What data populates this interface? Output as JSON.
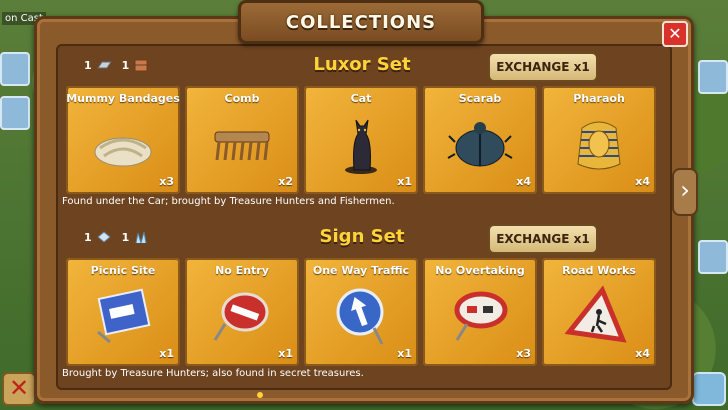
{
  "window": {
    "title": "COLLECTIONS",
    "close_symbol": "✕",
    "next_symbol": "›"
  },
  "scene": {
    "location_label": "on Cast"
  },
  "sets": [
    {
      "title": "Luxor Set",
      "exchange_label": "EXCHANGE x1",
      "requirements": [
        {
          "qty": "1",
          "icon": "metal-bar-icon"
        },
        {
          "qty": "1",
          "icon": "brick-icon"
        }
      ],
      "items": [
        {
          "name": "Mummy Bandages",
          "count": "x3",
          "icon": "bandage-icon"
        },
        {
          "name": "Comb",
          "count": "x2",
          "icon": "comb-icon"
        },
        {
          "name": "Cat",
          "count": "x1",
          "icon": "cat-statue-icon"
        },
        {
          "name": "Scarab",
          "count": "x4",
          "icon": "scarab-icon"
        },
        {
          "name": "Pharaoh",
          "count": "x4",
          "icon": "pharaoh-mask-icon"
        }
      ],
      "description": "Found under the Car; brought by Treasure Hunters and Fishermen."
    },
    {
      "title": "Sign Set",
      "exchange_label": "EXCHANGE x1",
      "requirements": [
        {
          "qty": "1",
          "icon": "glass-icon"
        },
        {
          "qty": "1",
          "icon": "crystal-icon"
        }
      ],
      "items": [
        {
          "name": "Picnic Site",
          "count": "x1",
          "icon": "picnic-sign-icon"
        },
        {
          "name": "No Entry",
          "count": "x1",
          "icon": "no-entry-sign-icon"
        },
        {
          "name": "One Way Traffic",
          "count": "x1",
          "icon": "one-way-sign-icon"
        },
        {
          "name": "No Overtaking",
          "count": "x3",
          "icon": "no-overtaking-sign-icon"
        },
        {
          "name": "Road Works",
          "count": "x4",
          "icon": "road-works-sign-icon"
        }
      ],
      "description": "Brought by Treasure Hunters; also found in secret treasures."
    }
  ],
  "colors": {
    "set_title": "#ffd23a",
    "card_bg": "#f2b53c",
    "frame": "#8b5a2b",
    "close": "#d8322a"
  }
}
